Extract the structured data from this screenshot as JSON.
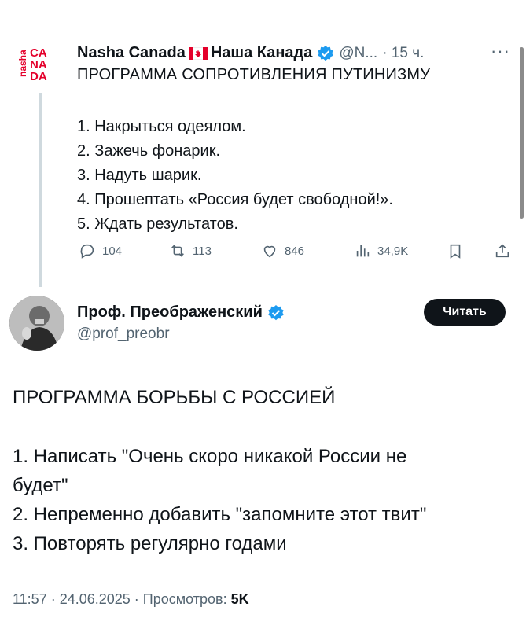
{
  "tweet1": {
    "avatar_text": "nasha CA NA DA",
    "display_name": "Nasha Canada",
    "display_name_ru": "Наша Канада",
    "handle": "@N...",
    "time": "· 15 ч.",
    "more": "···",
    "text": "ПРОГРАММА СОПРОТИВЛЕНИЯ ПУТИНИЗМУ",
    "items": [
      "1. Накрыться одеялом.",
      "2. Зажечь фонарик.",
      "3. Надуть шарик.",
      "4. Прошептать «Россия будет свободной!».",
      "5. Ждать результатов."
    ],
    "replies": "104",
    "retweets": "113",
    "likes": "846",
    "views": "34,9K",
    "icons": [
      "reply-icon",
      "retweet-icon",
      "like-icon",
      "views-icon",
      "bookmark-icon",
      "share-icon"
    ]
  },
  "tweet2": {
    "display_name": "Проф. Преображенский",
    "handle": "@prof_preobr",
    "follow_label": "Читать",
    "text": "ПРОГРАММА БОРЬБЫ С РОССИЕЙ",
    "items": [
      "1. Написать \"Очень скоро никакой России не",
      "будет\"",
      "2. Непременно добавить \"запомните этот твит\"",
      "3. Повторять регулярно годами"
    ],
    "footer_time": "11:57 · 24.06.2025 · Просмотров:",
    "footer_views": "5K"
  },
  "colors": {
    "verified": "#1d9bf0",
    "muted": "#536471",
    "text": "#0f1419",
    "brand_red": "#e4002b"
  }
}
